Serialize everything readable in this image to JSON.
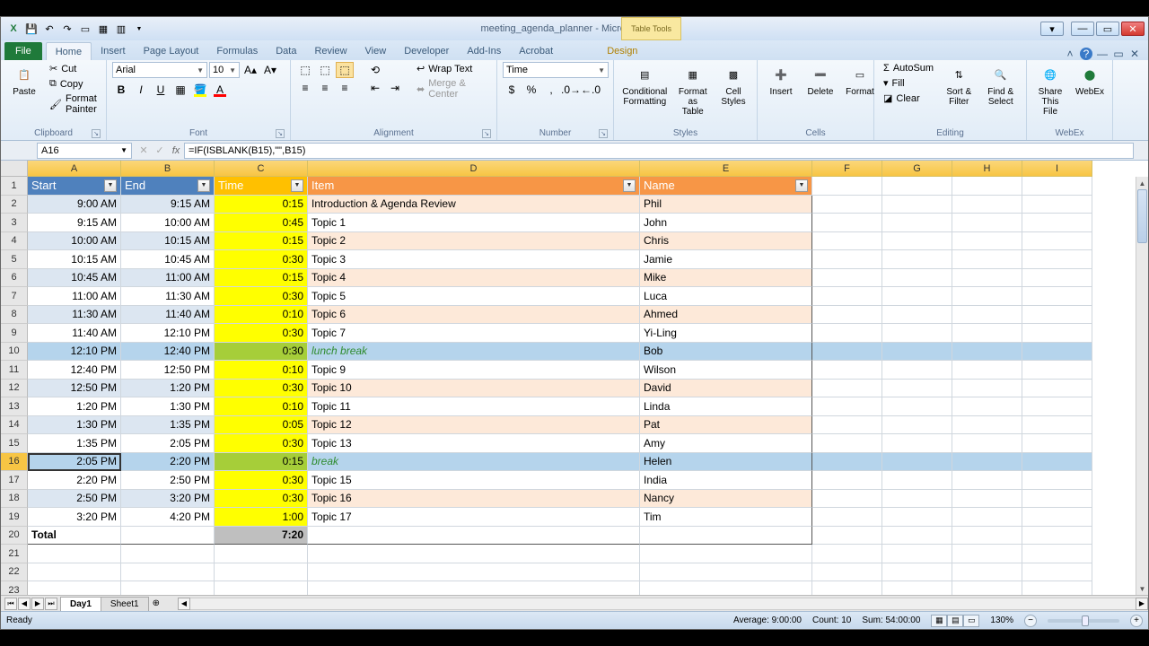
{
  "window": {
    "title": "meeting_agenda_planner - Microsoft Excel",
    "table_tools": "Table Tools",
    "design_tab": "Design"
  },
  "ribbon_tabs": [
    "Home",
    "Insert",
    "Page Layout",
    "Formulas",
    "Data",
    "Review",
    "View",
    "Developer",
    "Add-Ins",
    "Acrobat",
    "Design"
  ],
  "file_tab": "File",
  "clipboard": {
    "paste": "Paste",
    "cut": "Cut",
    "copy": "Copy",
    "format_painter": "Format Painter",
    "label": "Clipboard"
  },
  "font": {
    "name": "Arial",
    "size": "10",
    "label": "Font"
  },
  "alignment": {
    "wrap": "Wrap Text",
    "merge": "Merge & Center",
    "label": "Alignment"
  },
  "number": {
    "format": "Time",
    "label": "Number"
  },
  "styles": {
    "cond": "Conditional Formatting",
    "table": "Format as Table",
    "cell": "Cell Styles",
    "label": "Styles"
  },
  "cells": {
    "insert": "Insert",
    "delete": "Delete",
    "format": "Format",
    "label": "Cells"
  },
  "editing": {
    "autosum": "AutoSum",
    "fill": "Fill",
    "clear": "Clear",
    "sort": "Sort & Filter",
    "find": "Find & Select",
    "label": "Editing"
  },
  "right_addins": {
    "share": "Share This File",
    "webex": "WebEx",
    "label": "WebEx"
  },
  "name_box": "A16",
  "formula": "=IF(ISBLANK(B15),\"\",B15)",
  "columns": [
    "A",
    "B",
    "C",
    "D",
    "E",
    "F",
    "G",
    "H",
    "I"
  ],
  "headers": {
    "start": "Start",
    "end": "End",
    "time": "Time",
    "item": "Item",
    "name": "Name"
  },
  "rows": [
    {
      "n": 2,
      "start": "9:00 AM",
      "end": "9:15 AM",
      "time": "0:15",
      "item": "Introduction & Agenda Review",
      "name": "Phil",
      "brk": false
    },
    {
      "n": 3,
      "start": "9:15 AM",
      "end": "10:00 AM",
      "time": "0:45",
      "item": "Topic 1",
      "name": "John",
      "brk": false
    },
    {
      "n": 4,
      "start": "10:00 AM",
      "end": "10:15 AM",
      "time": "0:15",
      "item": "Topic 2",
      "name": "Chris",
      "brk": false
    },
    {
      "n": 5,
      "start": "10:15 AM",
      "end": "10:45 AM",
      "time": "0:30",
      "item": "Topic 3",
      "name": "Jamie",
      "brk": false
    },
    {
      "n": 6,
      "start": "10:45 AM",
      "end": "11:00 AM",
      "time": "0:15",
      "item": "Topic 4",
      "name": "Mike",
      "brk": false
    },
    {
      "n": 7,
      "start": "11:00 AM",
      "end": "11:30 AM",
      "time": "0:30",
      "item": "Topic 5",
      "name": "Luca",
      "brk": false
    },
    {
      "n": 8,
      "start": "11:30 AM",
      "end": "11:40 AM",
      "time": "0:10",
      "item": "Topic 6",
      "name": "Ahmed",
      "brk": false
    },
    {
      "n": 9,
      "start": "11:40 AM",
      "end": "12:10 PM",
      "time": "0:30",
      "item": "Topic 7",
      "name": "Yi-Ling",
      "brk": false
    },
    {
      "n": 10,
      "start": "12:10 PM",
      "end": "12:40 PM",
      "time": "0:30",
      "item": "lunch break",
      "name": "Bob",
      "brk": true
    },
    {
      "n": 11,
      "start": "12:40 PM",
      "end": "12:50 PM",
      "time": "0:10",
      "item": "Topic 9",
      "name": "Wilson",
      "brk": false
    },
    {
      "n": 12,
      "start": "12:50 PM",
      "end": "1:20 PM",
      "time": "0:30",
      "item": "Topic 10",
      "name": "David",
      "brk": false
    },
    {
      "n": 13,
      "start": "1:20 PM",
      "end": "1:30 PM",
      "time": "0:10",
      "item": "Topic 11",
      "name": "Linda",
      "brk": false
    },
    {
      "n": 14,
      "start": "1:30 PM",
      "end": "1:35 PM",
      "time": "0:05",
      "item": "Topic 12",
      "name": "Pat",
      "brk": false
    },
    {
      "n": 15,
      "start": "1:35 PM",
      "end": "2:05 PM",
      "time": "0:30",
      "item": "Topic 13",
      "name": "Amy",
      "brk": false
    },
    {
      "n": 16,
      "start": "2:05 PM",
      "end": "2:20 PM",
      "time": "0:15",
      "item": "break",
      "name": "Helen",
      "brk": true
    },
    {
      "n": 17,
      "start": "2:20 PM",
      "end": "2:50 PM",
      "time": "0:30",
      "item": "Topic 15",
      "name": "India",
      "brk": false
    },
    {
      "n": 18,
      "start": "2:50 PM",
      "end": "3:20 PM",
      "time": "0:30",
      "item": "Topic 16",
      "name": "Nancy",
      "brk": false
    },
    {
      "n": 19,
      "start": "3:20 PM",
      "end": "4:20 PM",
      "time": "1:00",
      "item": "Topic 17",
      "name": "Tim",
      "brk": false
    }
  ],
  "total": {
    "label": "Total",
    "time": "7:20"
  },
  "selected_row": 16,
  "sheets": [
    "Day1",
    "Sheet1"
  ],
  "status": {
    "ready": "Ready",
    "average": "Average: 9:00:00",
    "count": "Count: 10",
    "sum": "Sum: 54:00:00",
    "zoom": "130%"
  }
}
